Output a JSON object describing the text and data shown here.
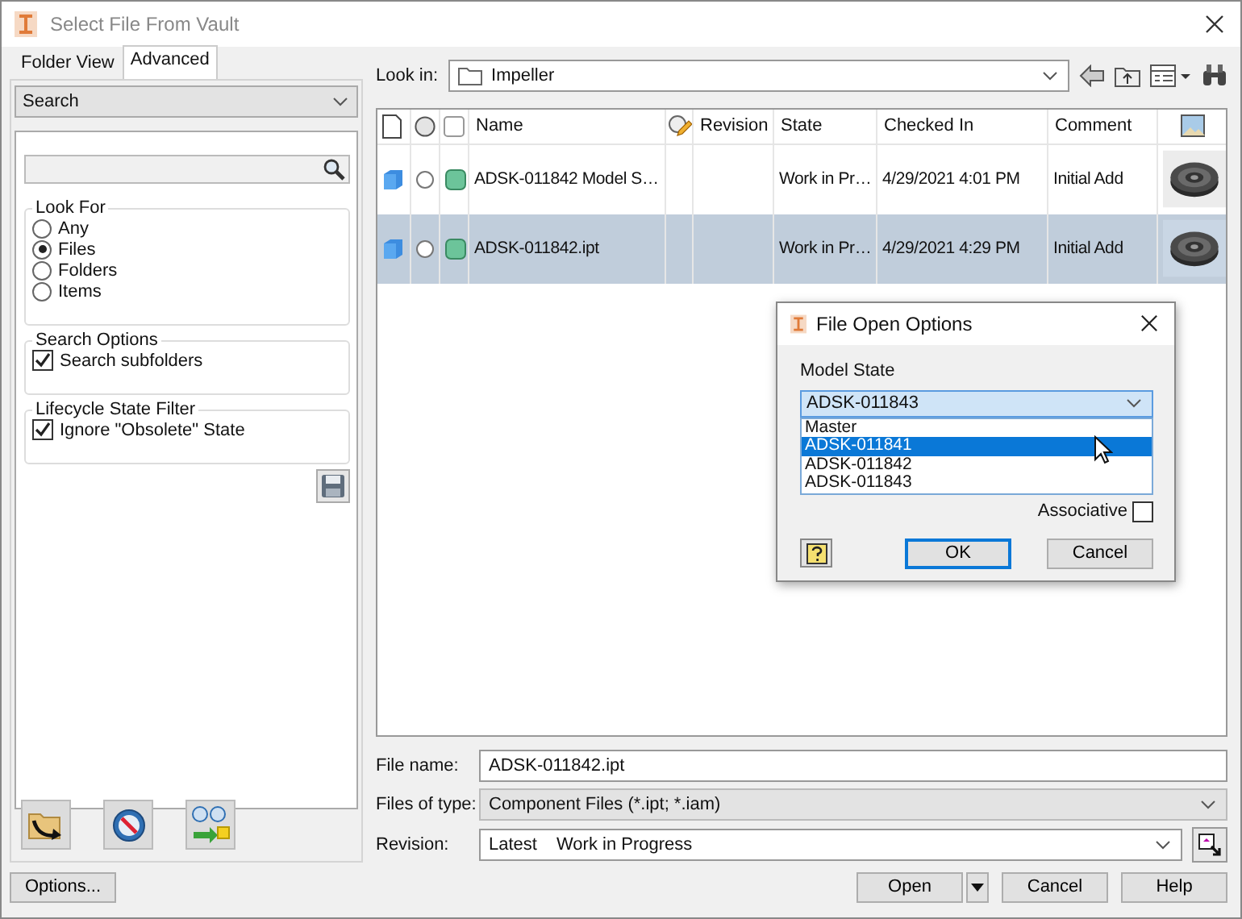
{
  "window": {
    "title": "Select File From Vault"
  },
  "tabs": [
    {
      "label": "Folder View",
      "selected": false
    },
    {
      "label": "Advanced",
      "selected": true
    }
  ],
  "view_select": {
    "value": "Search"
  },
  "look_for": {
    "title": "Look For",
    "options": [
      {
        "label": "Any",
        "selected": false
      },
      {
        "label": "Files",
        "selected": true
      },
      {
        "label": "Folders",
        "selected": false
      },
      {
        "label": "Items",
        "selected": false
      }
    ]
  },
  "search_options": {
    "title": "Search Options",
    "items": [
      {
        "label": "Search subfolders",
        "checked": true
      }
    ]
  },
  "lifecycle_filter": {
    "title": "Lifecycle State Filter",
    "items": [
      {
        "label": "Ignore \"Obsolete\" State",
        "checked": true
      }
    ]
  },
  "look_in": {
    "label": "Look in:",
    "value": "Impeller"
  },
  "table": {
    "columns": [
      "Name",
      "Revision",
      "State",
      "Checked In",
      "Comment"
    ],
    "rows": [
      {
        "name": "ADSK-011842 Model S…",
        "state": "Work in Pr…",
        "checked_in": "4/29/2021 4:01 PM",
        "comment": "Initial Add",
        "selected": false
      },
      {
        "name": "ADSK-011842.ipt",
        "state": "Work in Pr…",
        "checked_in": "4/29/2021 4:29 PM",
        "comment": "Initial Add",
        "selected": true
      }
    ]
  },
  "file_name": {
    "label": "File name:",
    "value": "ADSK-011842.ipt"
  },
  "files_of_type": {
    "label": "Files of type:",
    "value": "Component Files (*.ipt; *.iam)"
  },
  "revision": {
    "label": "Revision:",
    "value": "Latest",
    "state": "Work in Progress"
  },
  "buttons": {
    "options": "Options...",
    "open": "Open",
    "cancel": "Cancel",
    "help": "Help"
  },
  "dialog": {
    "title": "File Open Options",
    "model_state_label": "Model State",
    "model_state_value": "ADSK-011843",
    "options": [
      {
        "label": "Master",
        "selected": false
      },
      {
        "label": "ADSK-011841",
        "selected": true
      },
      {
        "label": "ADSK-011842",
        "selected": false
      },
      {
        "label": "ADSK-011843",
        "selected": false
      }
    ],
    "associative": {
      "label": "Associative",
      "checked": false
    },
    "ok": "OK",
    "cancel": "Cancel"
  }
}
